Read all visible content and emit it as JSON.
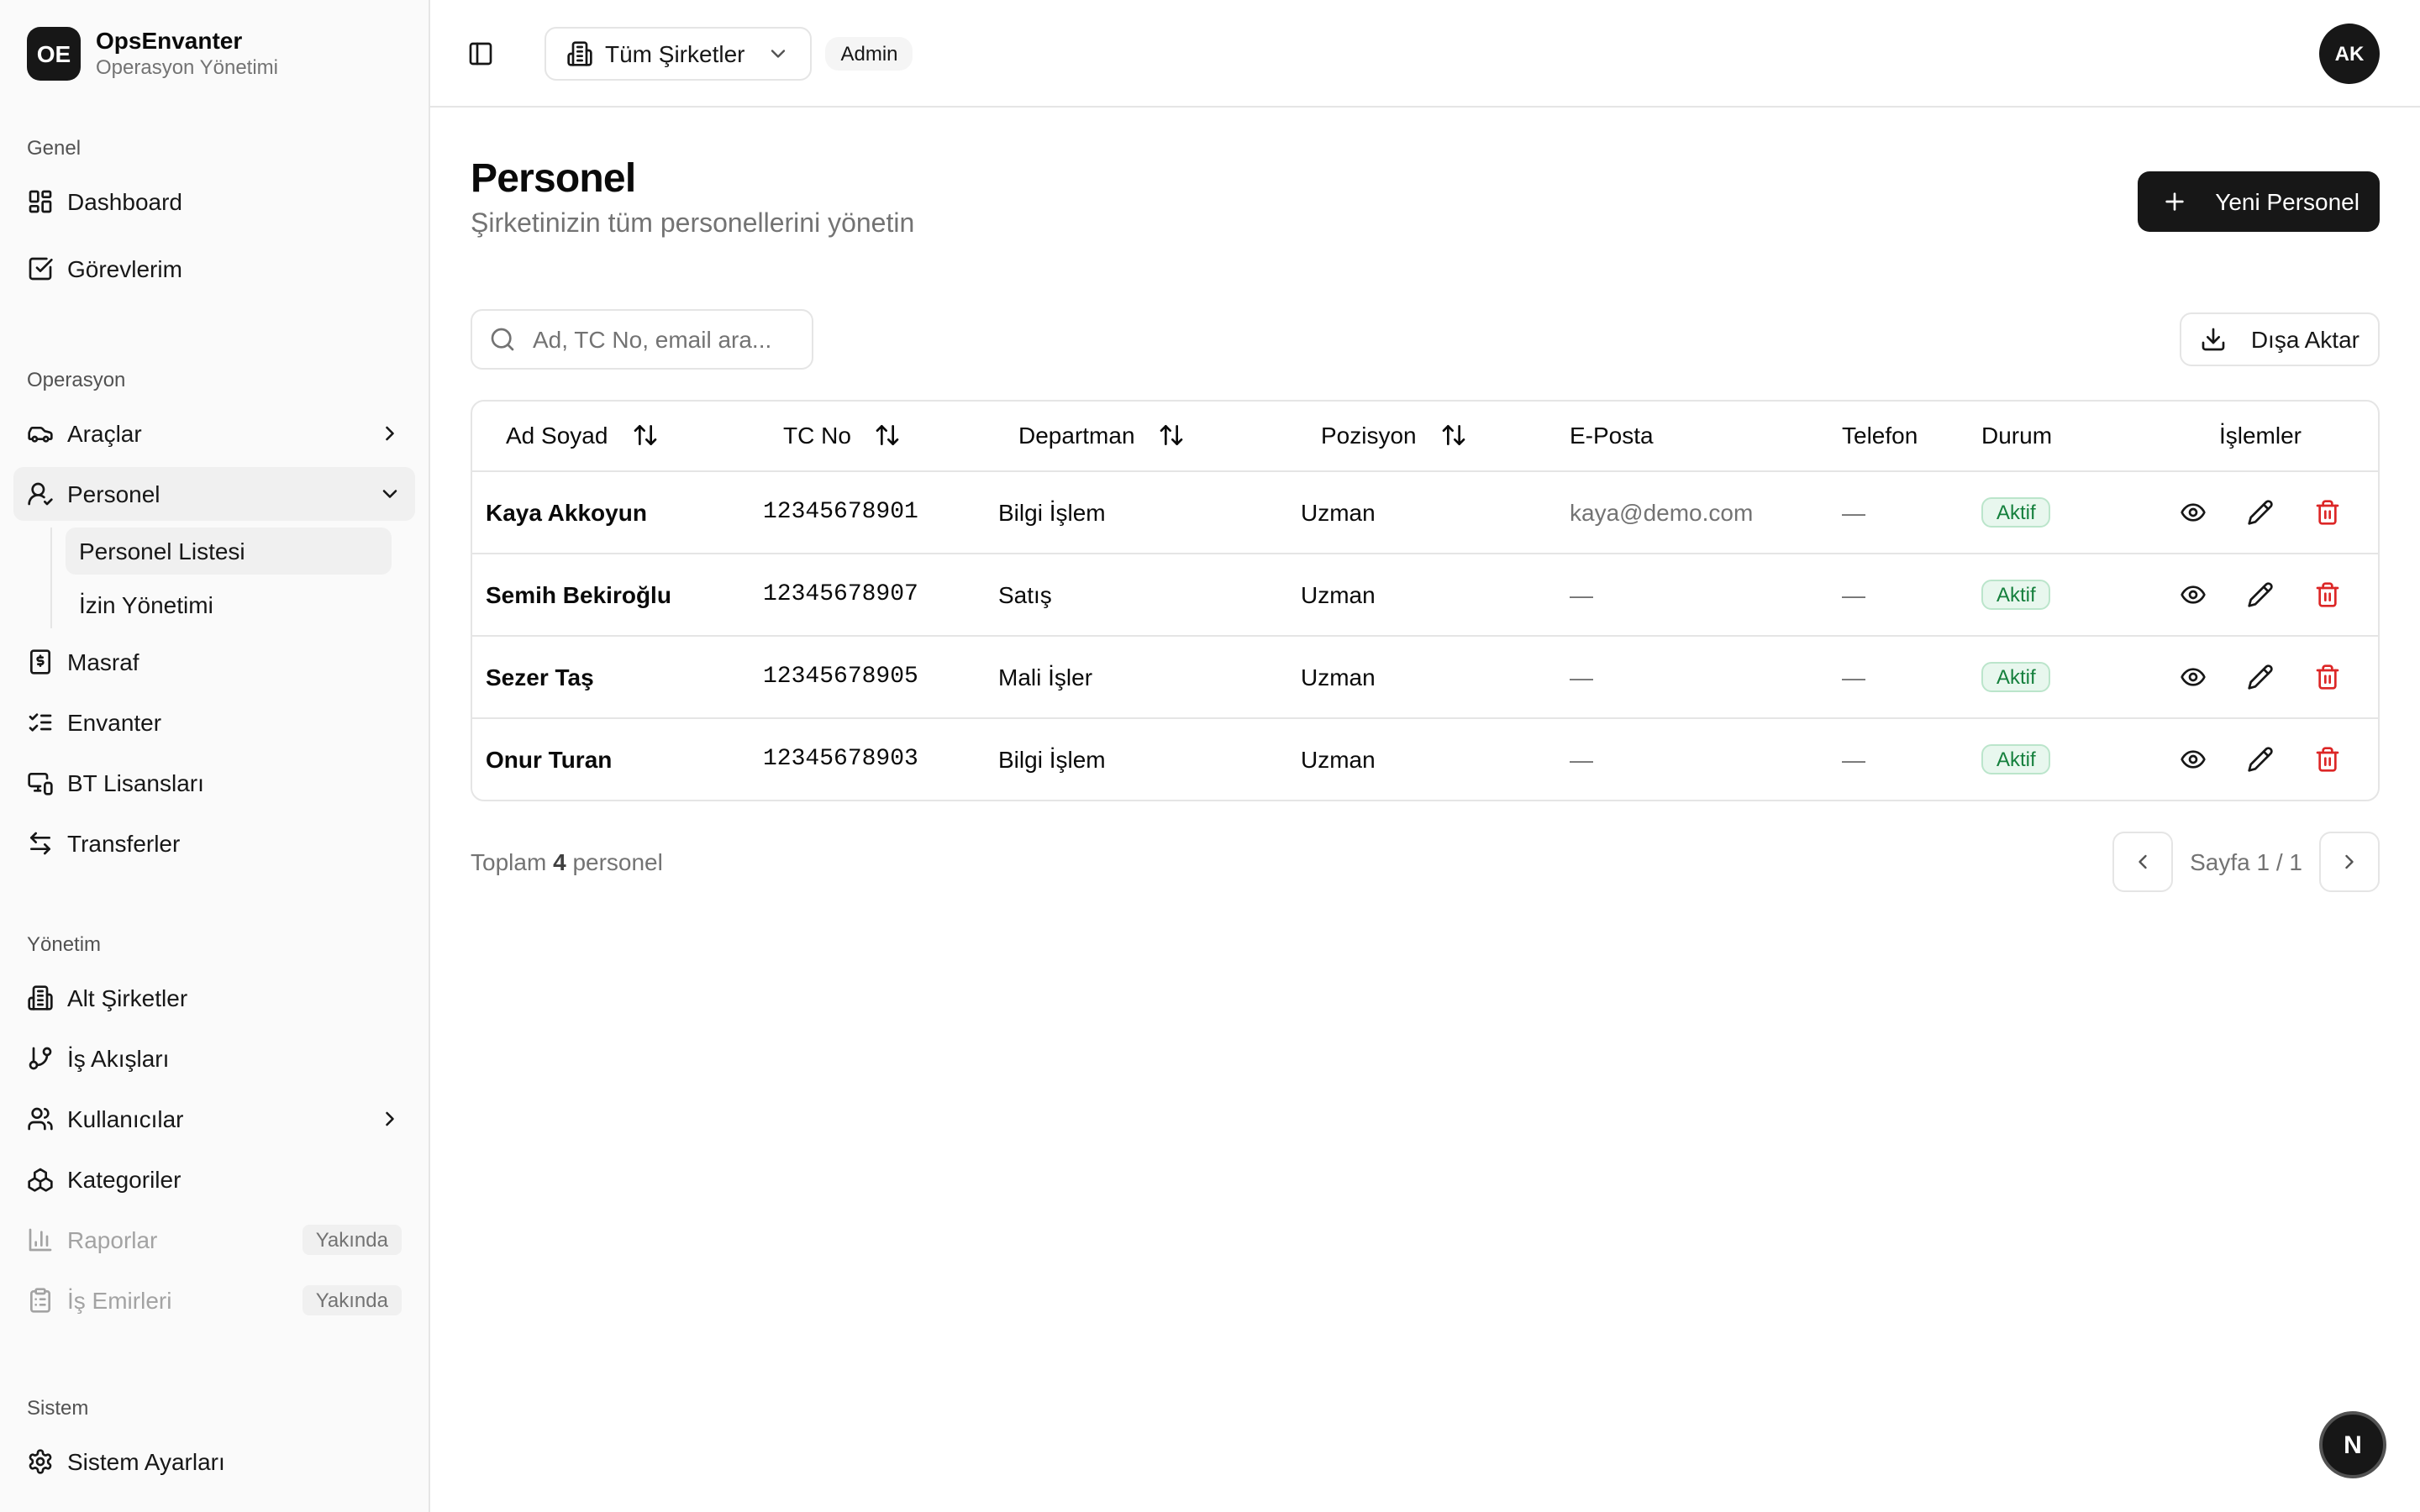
{
  "brand": {
    "logo": "OE",
    "name": "OpsEnvanter",
    "subtitle": "Operasyon Yönetimi"
  },
  "sidebar": {
    "groups": {
      "genel": {
        "label": "Genel",
        "items": {
          "dashboard": "Dashboard",
          "gorevlerim": "Görevlerim"
        }
      },
      "operasyon": {
        "label": "Operasyon",
        "items": {
          "araclar": "Araçlar",
          "personel": "Personel",
          "personel_listesi": "Personel Listesi",
          "izin_yonetimi": "İzin Yönetimi",
          "masraf": "Masraf",
          "envanter": "Envanter",
          "bt_lisanslari": "BT Lisansları",
          "transferler": "Transferler"
        }
      },
      "yonetim": {
        "label": "Yönetim",
        "items": {
          "alt_sirketler": "Alt Şirketler",
          "is_akislari": "İş Akışları",
          "kullanicilar": "Kullanıcılar",
          "kategoriler": "Kategoriler",
          "raporlar": "Raporlar",
          "is_emirleri": "İş Emirleri",
          "soon_label": "Yakında"
        }
      },
      "sistem": {
        "label": "Sistem",
        "items": {
          "sistem_ayarlari": "Sistem Ayarları"
        }
      }
    }
  },
  "topbar": {
    "company_select": "Tüm Şirketler",
    "role": "Admin",
    "avatar": "AK"
  },
  "page": {
    "title": "Personel",
    "subtitle": "Şirketinizin tüm personellerini yönetin",
    "new_button": "Yeni Personel",
    "search_placeholder": "Ad, TC No, email ara...",
    "export_button": "Dışa Aktar"
  },
  "table": {
    "columns": {
      "name": "Ad Soyad",
      "tc": "TC No",
      "department": "Departman",
      "position": "Pozisyon",
      "email": "E-Posta",
      "phone": "Telefon",
      "status": "Durum",
      "actions": "İşlemler"
    },
    "rows": [
      {
        "name": "Kaya Akkoyun",
        "tc": "12345678901",
        "department": "Bilgi İşlem",
        "position": "Uzman",
        "email": "kaya@demo.com",
        "phone": "—",
        "status": "Aktif"
      },
      {
        "name": "Semih Bekiroğlu",
        "tc": "12345678907",
        "department": "Satış",
        "position": "Uzman",
        "email": "—",
        "phone": "—",
        "status": "Aktif"
      },
      {
        "name": "Sezer Taş",
        "tc": "12345678905",
        "department": "Mali İşler",
        "position": "Uzman",
        "email": "—",
        "phone": "—",
        "status": "Aktif"
      },
      {
        "name": "Onur Turan",
        "tc": "12345678903",
        "department": "Bilgi İşlem",
        "position": "Uzman",
        "email": "—",
        "phone": "—",
        "status": "Aktif"
      }
    ]
  },
  "footer": {
    "total_prefix": "Toplam",
    "total_count": "4",
    "total_suffix": "personel",
    "page_info": "Sayfa 1 / 1"
  },
  "fab": {
    "label": "N"
  },
  "colors": {
    "primary": "#171717",
    "status_active_bg": "#e8f7ee",
    "status_active_text": "#15803d",
    "danger": "#dc2626"
  }
}
